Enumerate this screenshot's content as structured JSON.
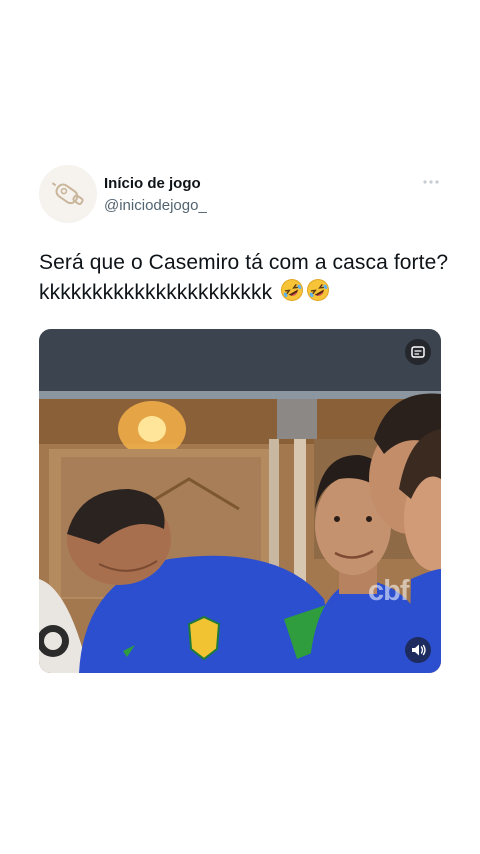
{
  "tweet": {
    "display_name": "Início de jogo",
    "handle": "@iniciodejogo_",
    "text": "Será que o Casemiro tá com a casca forte? kkkkkkkkkkkkkkkkkkkkkk",
    "emojis": [
      "rolling-on-floor-laughing-emoji",
      "rolling-on-floor-laughing-emoji"
    ],
    "media": {
      "watermark": "cbf",
      "icons": [
        "captions-icon",
        "volume-icon"
      ]
    }
  },
  "icons": {
    "avatar": "whistle-icon",
    "more": "more-options-icon"
  },
  "colors": {
    "text_primary": "#0f1419",
    "text_secondary": "#536471",
    "jersey_blue": "#2c4fd0",
    "accent_green": "#2f9c3d"
  }
}
